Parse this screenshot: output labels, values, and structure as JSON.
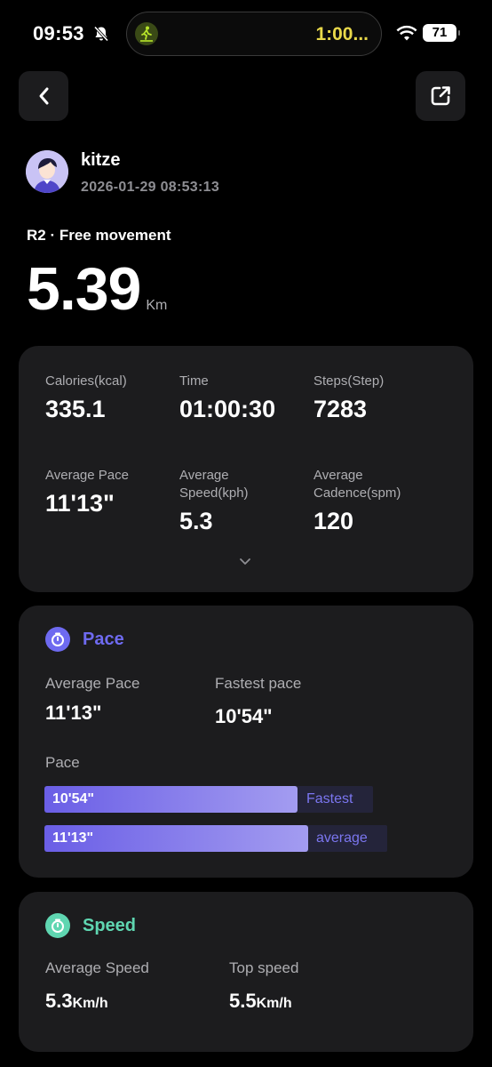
{
  "status_bar": {
    "time": "09:53",
    "activity_timer": "1:00...",
    "battery": "71"
  },
  "user": {
    "name": "kitze",
    "datetime": "2026-01-29 08:53:13"
  },
  "workout": {
    "mode": "R2 · Free movement",
    "distance": "5.39",
    "distance_unit": "Km"
  },
  "summary": {
    "stats": [
      {
        "label": "Calories(kcal)",
        "value": "335.1"
      },
      {
        "label": "Time",
        "value": "01:00:30"
      },
      {
        "label": "Steps(Step)",
        "value": "7283"
      },
      {
        "label": "Average Pace",
        "value": "11'13\""
      },
      {
        "label": "Average Speed(kph)",
        "value": "5.3"
      },
      {
        "label": "Average Cadence(spm)",
        "value": "120"
      }
    ]
  },
  "pace": {
    "title": "Pace",
    "avg_label": "Average Pace",
    "avg_value": "11'13\"",
    "fastest_label": "Fastest pace",
    "fastest_value": "10'54\"",
    "chart_label": "Pace",
    "bars": [
      {
        "value": "10'54\"",
        "tag": "Fastest",
        "fill_fraction": 0.92
      },
      {
        "value": "11'13\"",
        "tag": "average",
        "fill_fraction": 0.9
      }
    ]
  },
  "speed": {
    "title": "Speed",
    "avg_label": "Average Speed",
    "avg_value": "5.3",
    "avg_unit": "Km/h",
    "top_label": "Top speed",
    "top_value": "5.5",
    "top_unit": "Km/h"
  },
  "colors": {
    "background": "#000000",
    "card": "#1c1c1e",
    "pace_accent": "#6e6af0",
    "speed_accent": "#5fd6b1",
    "timer": "#e8d84a"
  }
}
